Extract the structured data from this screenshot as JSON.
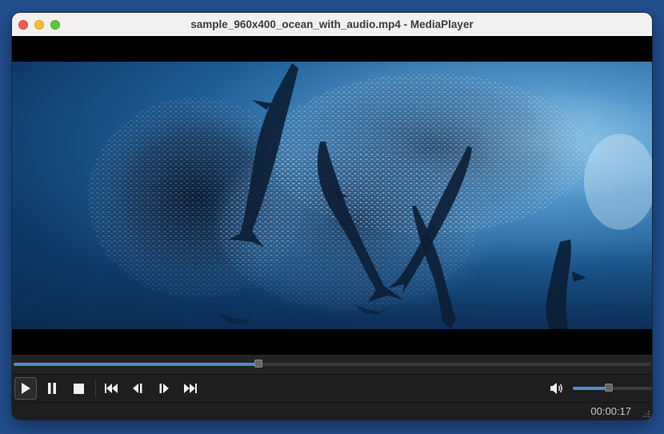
{
  "window": {
    "title": "sample_960x400_ocean_with_audio.mp4 - MediaPlayer"
  },
  "playback": {
    "progress_fraction": 0.385,
    "volume_fraction": 0.45,
    "time": "00:00:17"
  },
  "controls": [
    {
      "name": "play-icon",
      "state": "active"
    },
    {
      "name": "pause-icon"
    },
    {
      "name": "stop-icon"
    },
    {
      "name": "skip-previous-icon"
    },
    {
      "name": "frame-back-icon"
    },
    {
      "name": "frame-forward-icon"
    },
    {
      "name": "skip-next-icon"
    }
  ],
  "colors": {
    "accent": "#4a8fd6",
    "desktop": "#234f8f",
    "controls_bg": "#1e1e1e"
  }
}
